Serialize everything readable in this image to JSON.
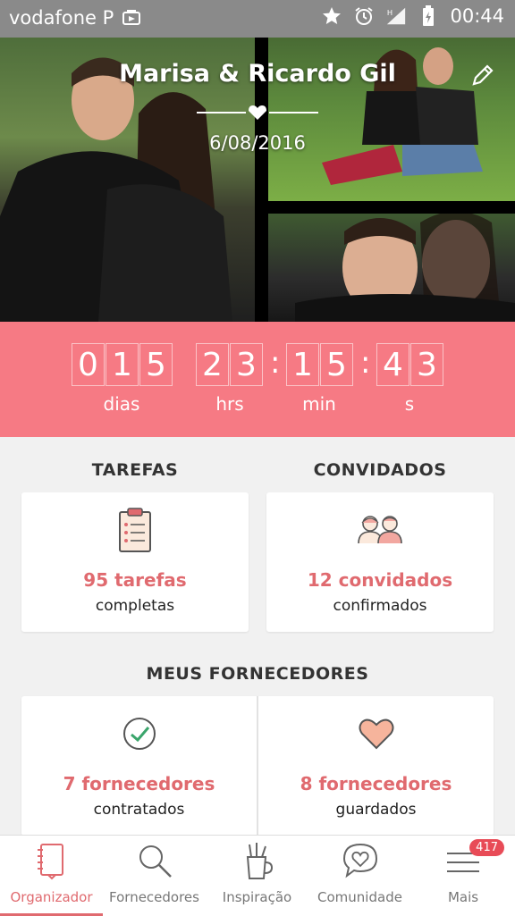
{
  "status_bar": {
    "carrier": "vodafone P",
    "time": "00:44",
    "icons": [
      "cast-icon",
      "star-icon",
      "alarm-icon",
      "signal-icon",
      "battery-icon"
    ]
  },
  "hero": {
    "title": "Marisa & Ricardo Gil",
    "date": "6/08/2016",
    "edit_icon": "pencil-icon"
  },
  "countdown": {
    "days_digits": [
      "0",
      "1",
      "5"
    ],
    "hours_digits": [
      "2",
      "3"
    ],
    "minutes_digits": [
      "1",
      "5"
    ],
    "seconds_digits": [
      "4",
      "3"
    ],
    "days_label": "dias",
    "hours_label": "hrs",
    "minutes_label": "min",
    "seconds_label": "s"
  },
  "tasks": {
    "heading": "TAREFAS",
    "count_text": "95 tarefas",
    "sub_text": "completas",
    "icon": "clipboard-icon"
  },
  "guests": {
    "heading": "CONVIDADOS",
    "count_text": "12 convidados",
    "sub_text": "confirmados",
    "icon": "guests-icon"
  },
  "vendors": {
    "heading": "MEUS FORNECEDORES",
    "hired_text": "7 fornecedores",
    "hired_sub": "contratados",
    "saved_text": "8 fornecedores",
    "saved_sub": "guardados"
  },
  "nav": {
    "items": [
      {
        "label": "Organizador",
        "icon": "notebook-icon",
        "active": true
      },
      {
        "label": "Fornecedores",
        "icon": "search-icon",
        "active": false
      },
      {
        "label": "Inspiração",
        "icon": "inspiration-icon",
        "active": false
      },
      {
        "label": "Comunidade",
        "icon": "chat-heart-icon",
        "active": false
      },
      {
        "label": "Mais",
        "icon": "menu-icon",
        "active": false
      }
    ],
    "badge": "417"
  },
  "colors": {
    "accent": "#f67a84",
    "accent_text": "#e06a6f",
    "status_bar": "#8a8a8a",
    "badge": "#e84b57"
  }
}
